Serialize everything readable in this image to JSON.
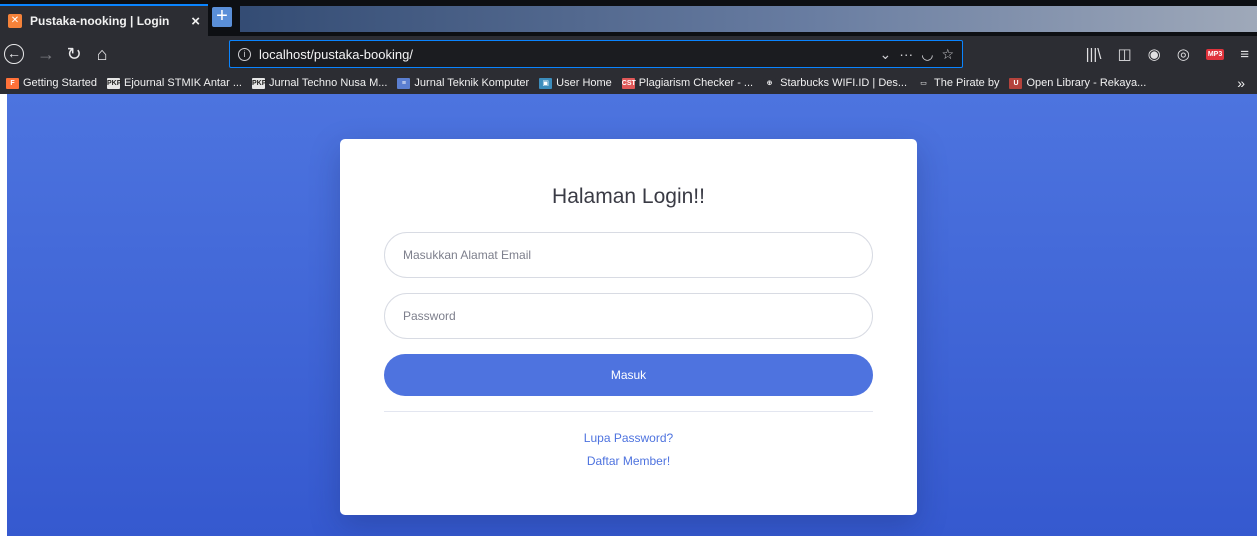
{
  "browser": {
    "tab": {
      "title": "Pustaka-nooking | Login",
      "favicon": "xampp-icon",
      "close": "×"
    },
    "new_tab": "+",
    "nav": {
      "back": "←",
      "forward": "→",
      "reload": "↻",
      "home": "⌂"
    },
    "url": "localhost/pustaka-booking/",
    "url_actions": {
      "dropdown": "⌄",
      "more": "···",
      "pocket": "◡",
      "bookmark": "☆"
    },
    "toolbar": {
      "library": "|||\\",
      "sidebar": "◫",
      "globe": "◉",
      "account": "◎",
      "mp3": "MP3",
      "menu": "≡"
    },
    "bookmarks": [
      {
        "label": "Getting Started",
        "icon": "F",
        "color": "#ff7139"
      },
      {
        "label": "Ejournal STMIK Antar ...",
        "icon": "PKP",
        "color": "#e6e6e6"
      },
      {
        "label": "Jurnal Techno Nusa M...",
        "icon": "PKP",
        "color": "#e6e6e6"
      },
      {
        "label": "Jurnal Teknik Komputer",
        "icon": "≡",
        "color": "#5b7fd1"
      },
      {
        "label": "User Home",
        "icon": "▣",
        "color": "#3c8dbc"
      },
      {
        "label": "Plagiarism Checker - ...",
        "icon": "CST",
        "color": "#e05858"
      },
      {
        "label": "Starbucks WIFI.ID | Des...",
        "icon": "⊕",
        "color": "#2c2d33"
      },
      {
        "label": "The Pirate by",
        "icon": "▭",
        "color": "#2c2d33"
      },
      {
        "label": "Open Library - Rekaya...",
        "icon": "U",
        "color": "#b5433c"
      }
    ],
    "bookmarks_overflow": "»"
  },
  "login": {
    "title": "Halaman Login!!",
    "email_placeholder": "Masukkan Alamat Email",
    "password_placeholder": "Password",
    "submit_label": "Masuk",
    "forgot_link": "Lupa Password?",
    "register_link": "Daftar Member!"
  },
  "colors": {
    "primary": "#4e73df",
    "page_bg_top": "#4d74df",
    "page_bg_bottom": "#3559cf"
  }
}
